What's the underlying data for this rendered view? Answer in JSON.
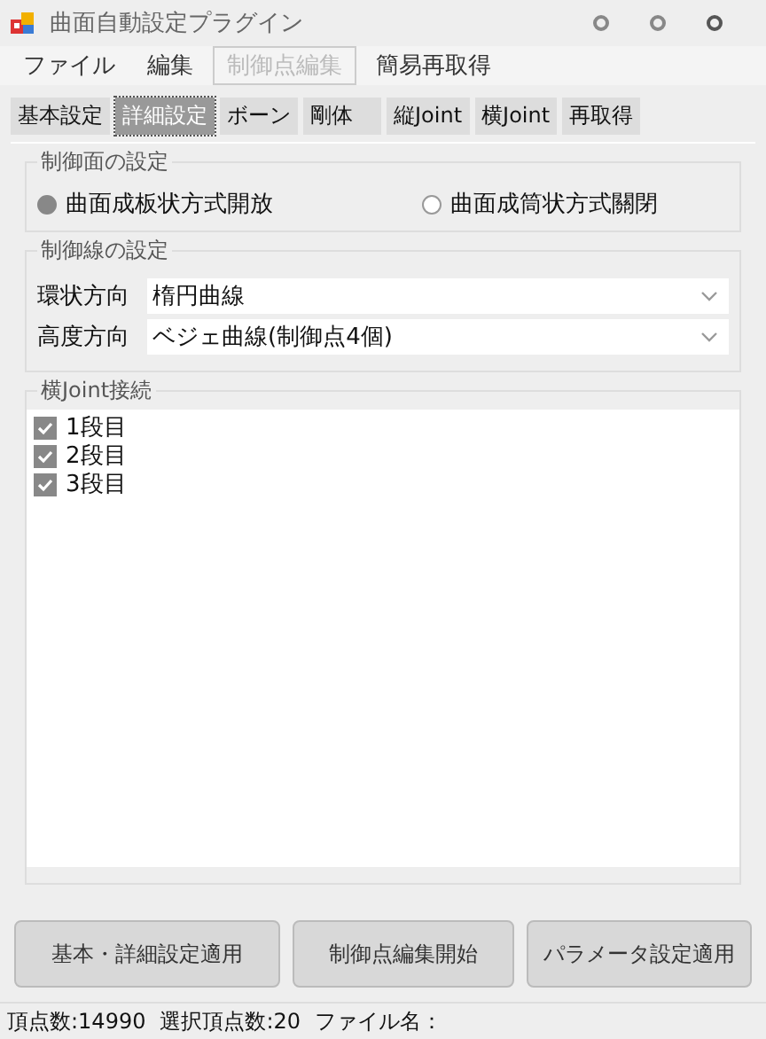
{
  "window": {
    "title": "曲面自動設定プラグイン"
  },
  "menu": [
    {
      "label": "ファイル",
      "disabled": false
    },
    {
      "label": "編集",
      "disabled": false
    },
    {
      "label": "制御点編集",
      "disabled": true
    },
    {
      "label": "簡易再取得",
      "disabled": false
    }
  ],
  "tabs": [
    {
      "label": "基本設定",
      "selected": false
    },
    {
      "label": "詳細設定",
      "selected": true
    },
    {
      "label": "ボーン",
      "selected": false
    },
    {
      "label": "剛体",
      "selected": false
    },
    {
      "label": "縦Joint",
      "selected": false
    },
    {
      "label": "横Joint",
      "selected": false
    },
    {
      "label": "再取得",
      "selected": false
    }
  ],
  "surface_group": {
    "title": "制御面の設定",
    "options": [
      {
        "label": "曲面成板状方式開放",
        "selected": true
      },
      {
        "label": "曲面成筒状方式關閉",
        "selected": false
      }
    ]
  },
  "line_group": {
    "title": "制御線の設定",
    "fields": [
      {
        "label": "環状方向",
        "value": "楕円曲線"
      },
      {
        "label": "高度方向",
        "value": "ベジェ曲線(制御点4個)"
      }
    ]
  },
  "joint_group": {
    "title": "横Joint接続",
    "items": [
      {
        "label": "1段目",
        "checked": true
      },
      {
        "label": "2段目",
        "checked": true
      },
      {
        "label": "3段目",
        "checked": true
      }
    ]
  },
  "buttons": [
    "基本・詳細設定適用",
    "制御点編集開始",
    "パラメータ設定適用"
  ],
  "status_bar": [
    "頂点数:14990",
    "選択頂点数:20",
    "ファイル名："
  ]
}
